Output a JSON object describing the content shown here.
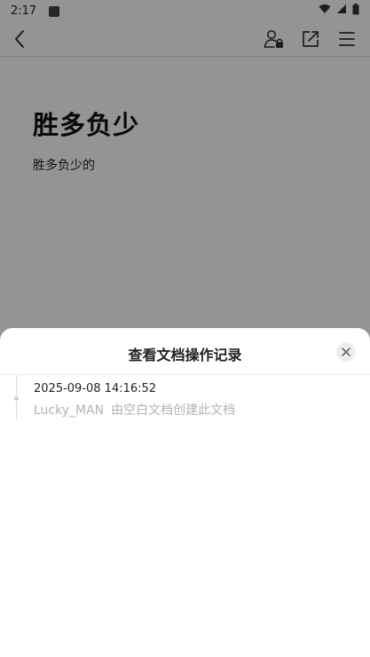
{
  "status_bar": {
    "time": "2:17"
  },
  "toolbar": {
    "back": "back-icon",
    "icons": [
      "user-lock-icon",
      "share-external-icon",
      "menu-icon"
    ]
  },
  "document": {
    "title": "胜多负少",
    "body": "胜多负少的"
  },
  "history_sheet": {
    "title": "查看文档操作记录",
    "close": "close-icon",
    "entries": [
      {
        "time": "2025-09-08 14:16:52",
        "user": "Lucky_MAN",
        "action": "由空白文档创建此文档"
      }
    ]
  },
  "colors": {
    "scrim": "#6b6b6b",
    "sheet_bg": "#ffffff",
    "muted_text": "#b3b3b3"
  }
}
